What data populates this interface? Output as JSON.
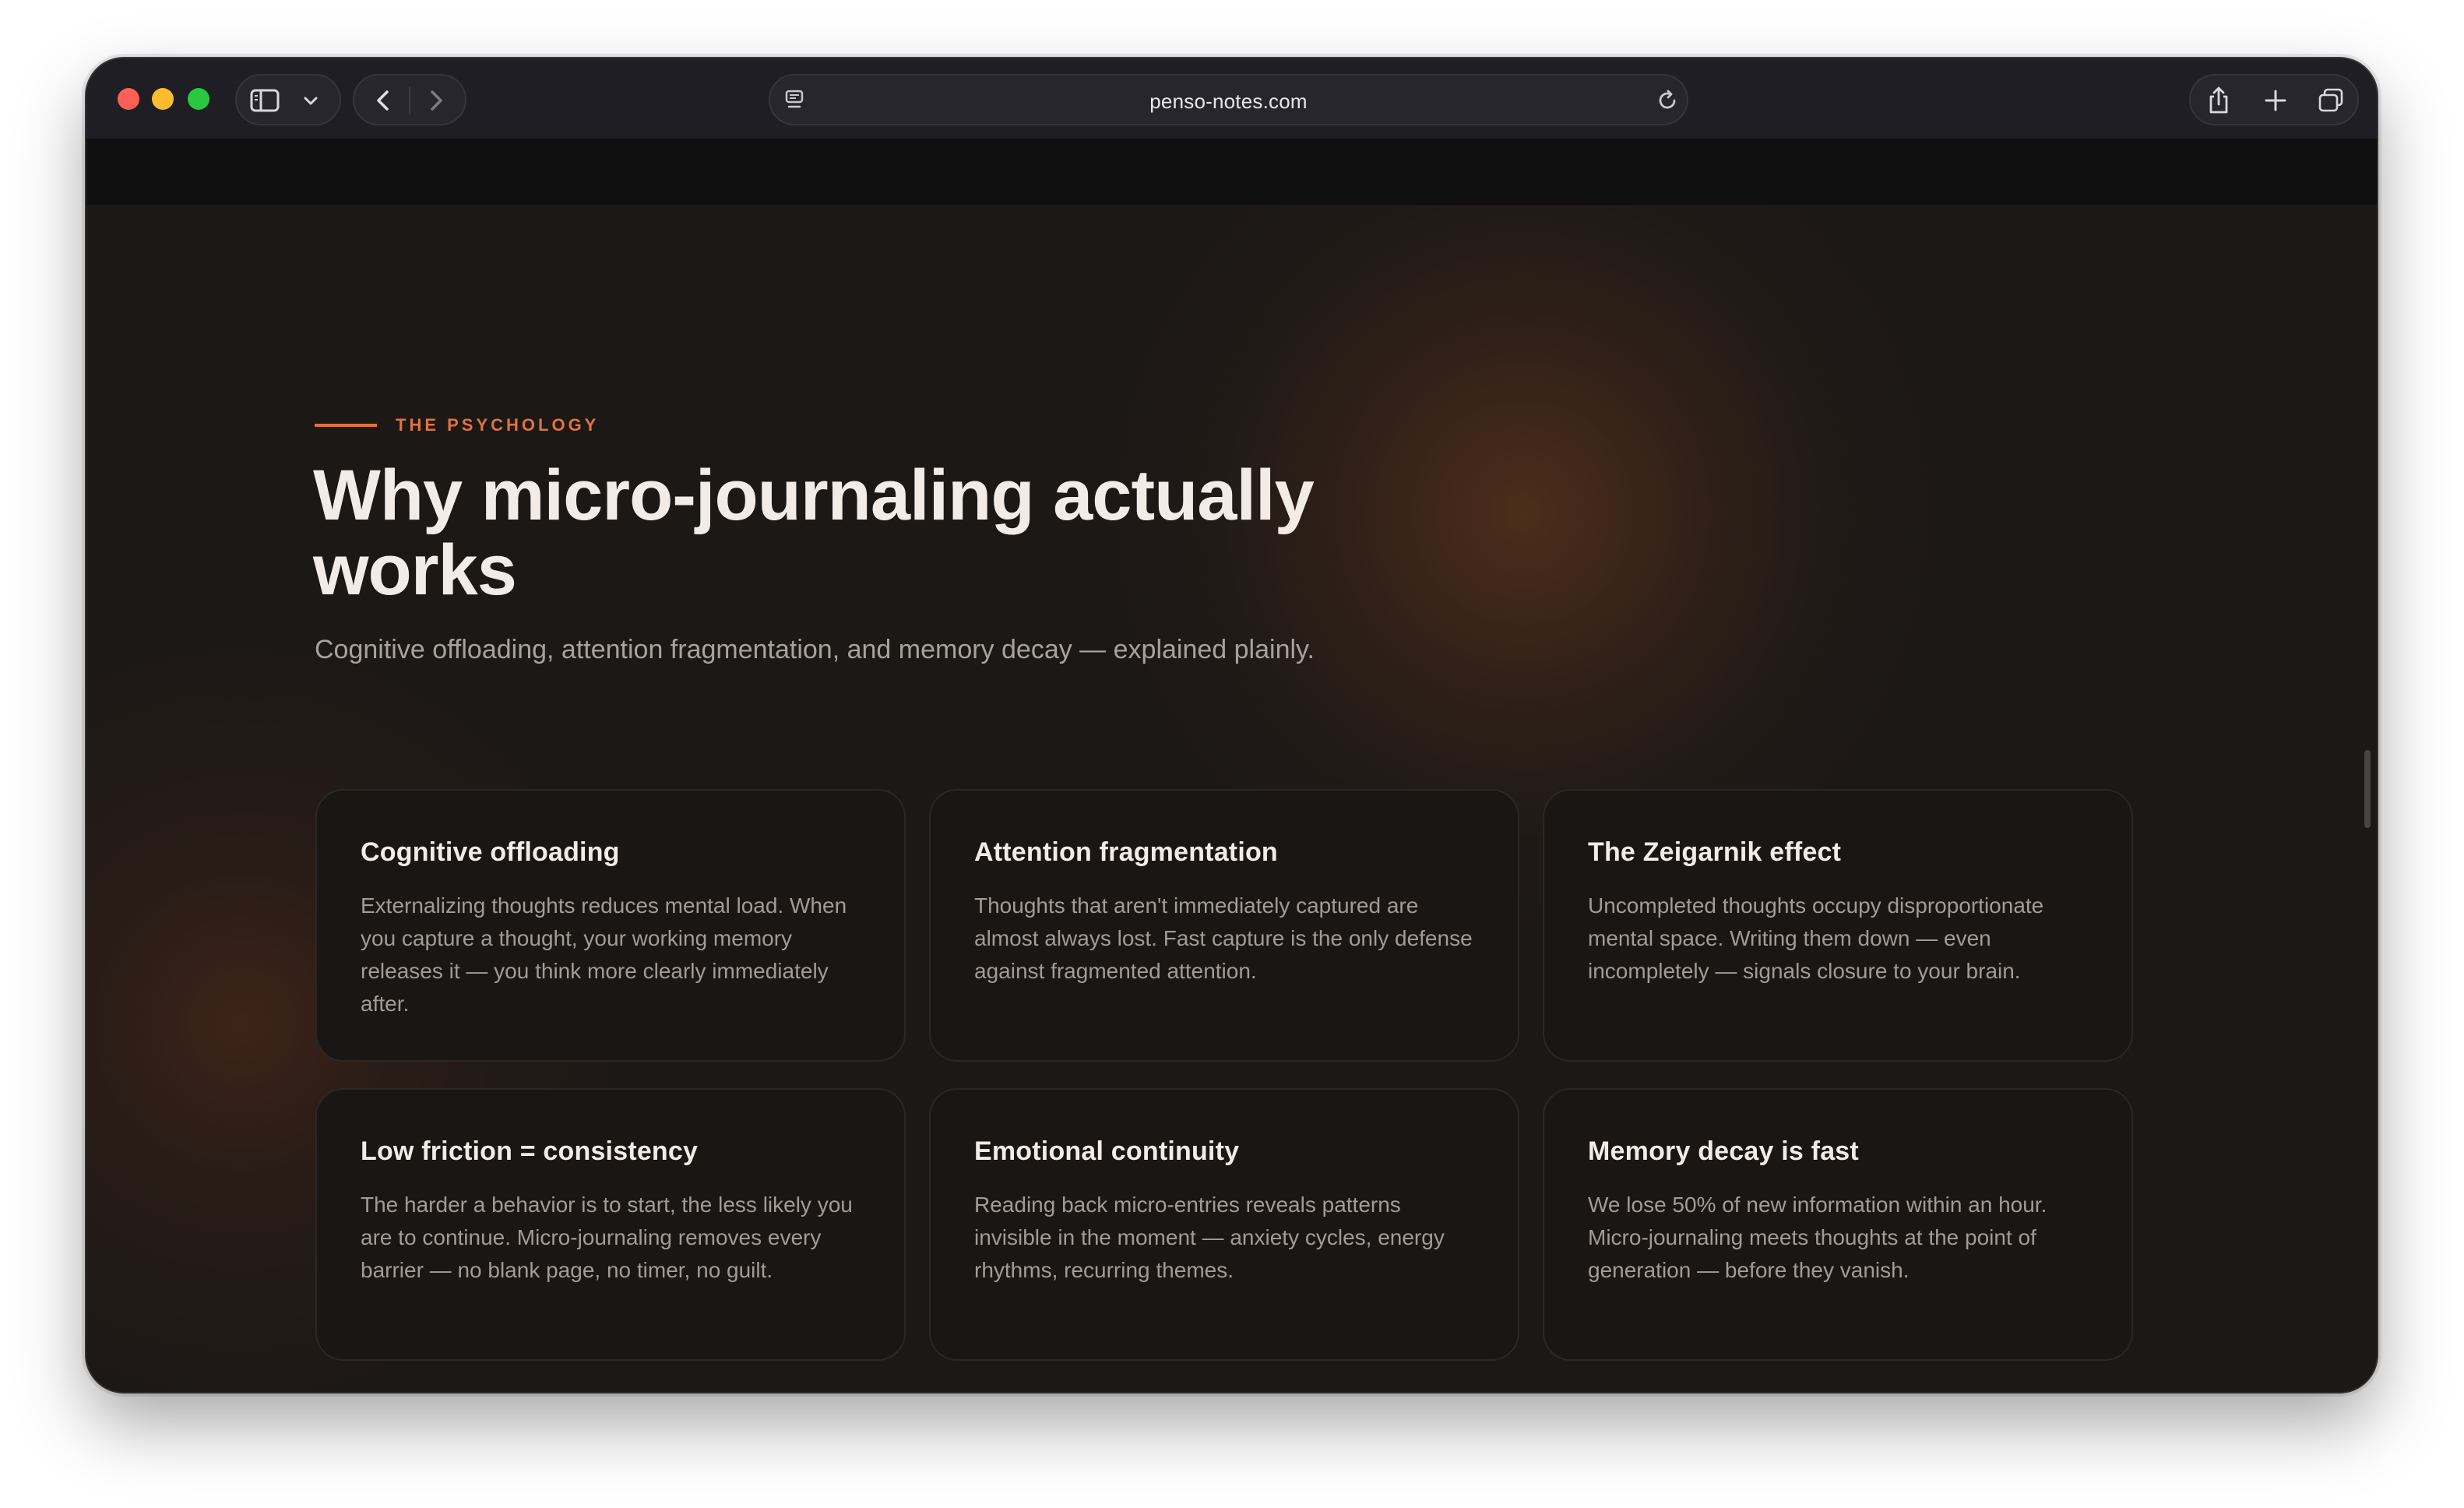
{
  "browser": {
    "url": "penso-notes.com"
  },
  "section": {
    "eyebrow": "THE PSYCHOLOGY",
    "headline": "Why micro-journaling actually works",
    "subhead": "Cognitive offloading, attention fragmentation, and memory decay — explained plainly."
  },
  "cards": [
    {
      "title": "Cognitive offloading",
      "body": "Externalizing thoughts reduces mental load. When you capture a thought, your working memory releases it — you think more clearly immediately after."
    },
    {
      "title": "Attention fragmentation",
      "body": "Thoughts that aren't immediately captured are almost always lost. Fast capture is the only defense against fragmented attention."
    },
    {
      "title": "The Zeigarnik effect",
      "body": "Uncompleted thoughts occupy disproportionate mental space. Writing them down — even incompletely — signals closure to your brain."
    },
    {
      "title": "Low friction = consistency",
      "body": "The harder a behavior is to start, the less likely you are to continue. Micro-journaling removes every barrier — no blank page, no timer, no guilt."
    },
    {
      "title": "Emotional continuity",
      "body": "Reading back micro-entries reveals patterns invisible in the moment — anxiety cycles, energy rhythms, recurring themes."
    },
    {
      "title": "Memory decay is fast",
      "body": "We lose 50% of new information within an hour. Micro-journaling meets thoughts at the point of generation — before they vanish."
    }
  ],
  "colors": {
    "accent": "#e0733e",
    "background": "#1b1816",
    "card": "#1a1614"
  }
}
